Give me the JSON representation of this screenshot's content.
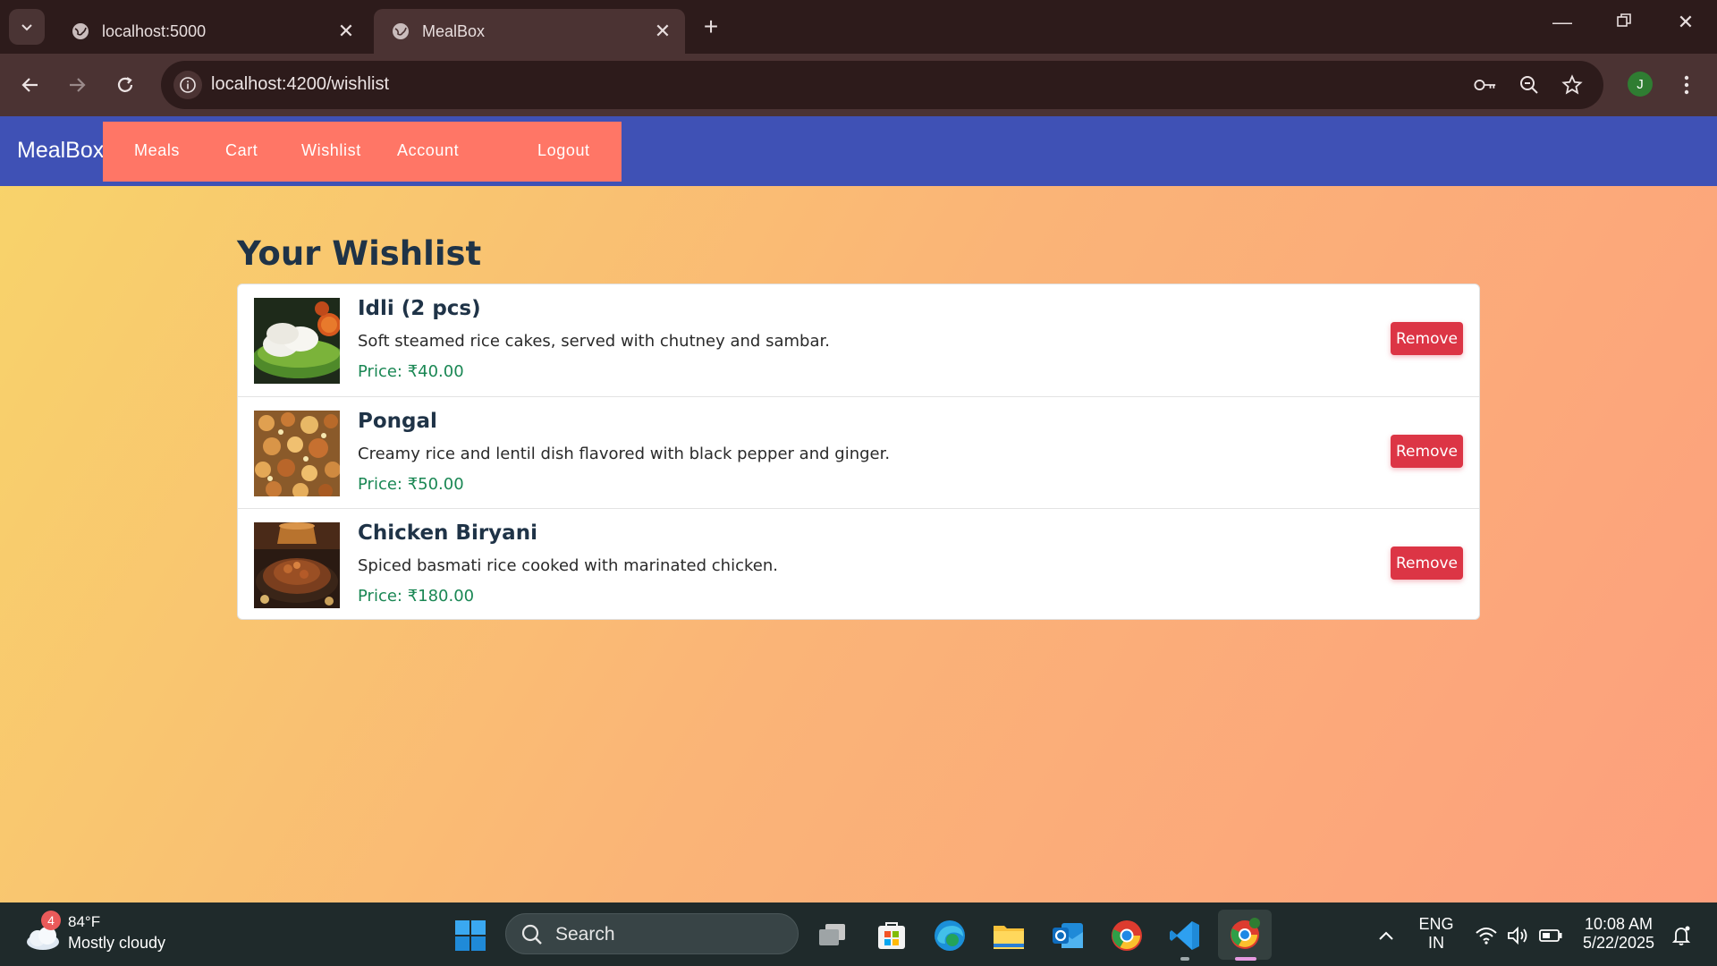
{
  "browser": {
    "tabs": [
      {
        "title": "localhost:5000",
        "active": false
      },
      {
        "title": "MealBox",
        "active": true
      }
    ],
    "url": "localhost:4200/wishlist",
    "profile_initial": "J"
  },
  "app": {
    "brand": "MealBox",
    "nav": [
      "Meals",
      "Cart",
      "Wishlist",
      "Account",
      "Logout"
    ],
    "colors": {
      "navbar": "#3f51b5",
      "menu": "#ff7666",
      "remove": "#dc3545",
      "price": "#1a8754"
    }
  },
  "wishlist": {
    "heading": "Your Wishlist",
    "remove_label": "Remove",
    "items": [
      {
        "name": "Idli (2 pcs)",
        "description": "Soft steamed rice cakes, served with chutney and sambar.",
        "price": "Price: ₹40.00"
      },
      {
        "name": "Pongal",
        "description": "Creamy rice and lentil dish flavored with black pepper and ginger.",
        "price": "Price: ₹50.00"
      },
      {
        "name": "Chicken Biryani",
        "description": "Spiced basmati rice cooked with marinated chicken.",
        "price": "Price: ₹180.00"
      }
    ]
  },
  "taskbar": {
    "weather": {
      "badge": "4",
      "temp": "84°F",
      "desc": "Mostly cloudy"
    },
    "search": "Search",
    "lang": {
      "line1": "ENG",
      "line2": "IN"
    },
    "time": "10:08 AM",
    "date": "5/22/2025"
  }
}
